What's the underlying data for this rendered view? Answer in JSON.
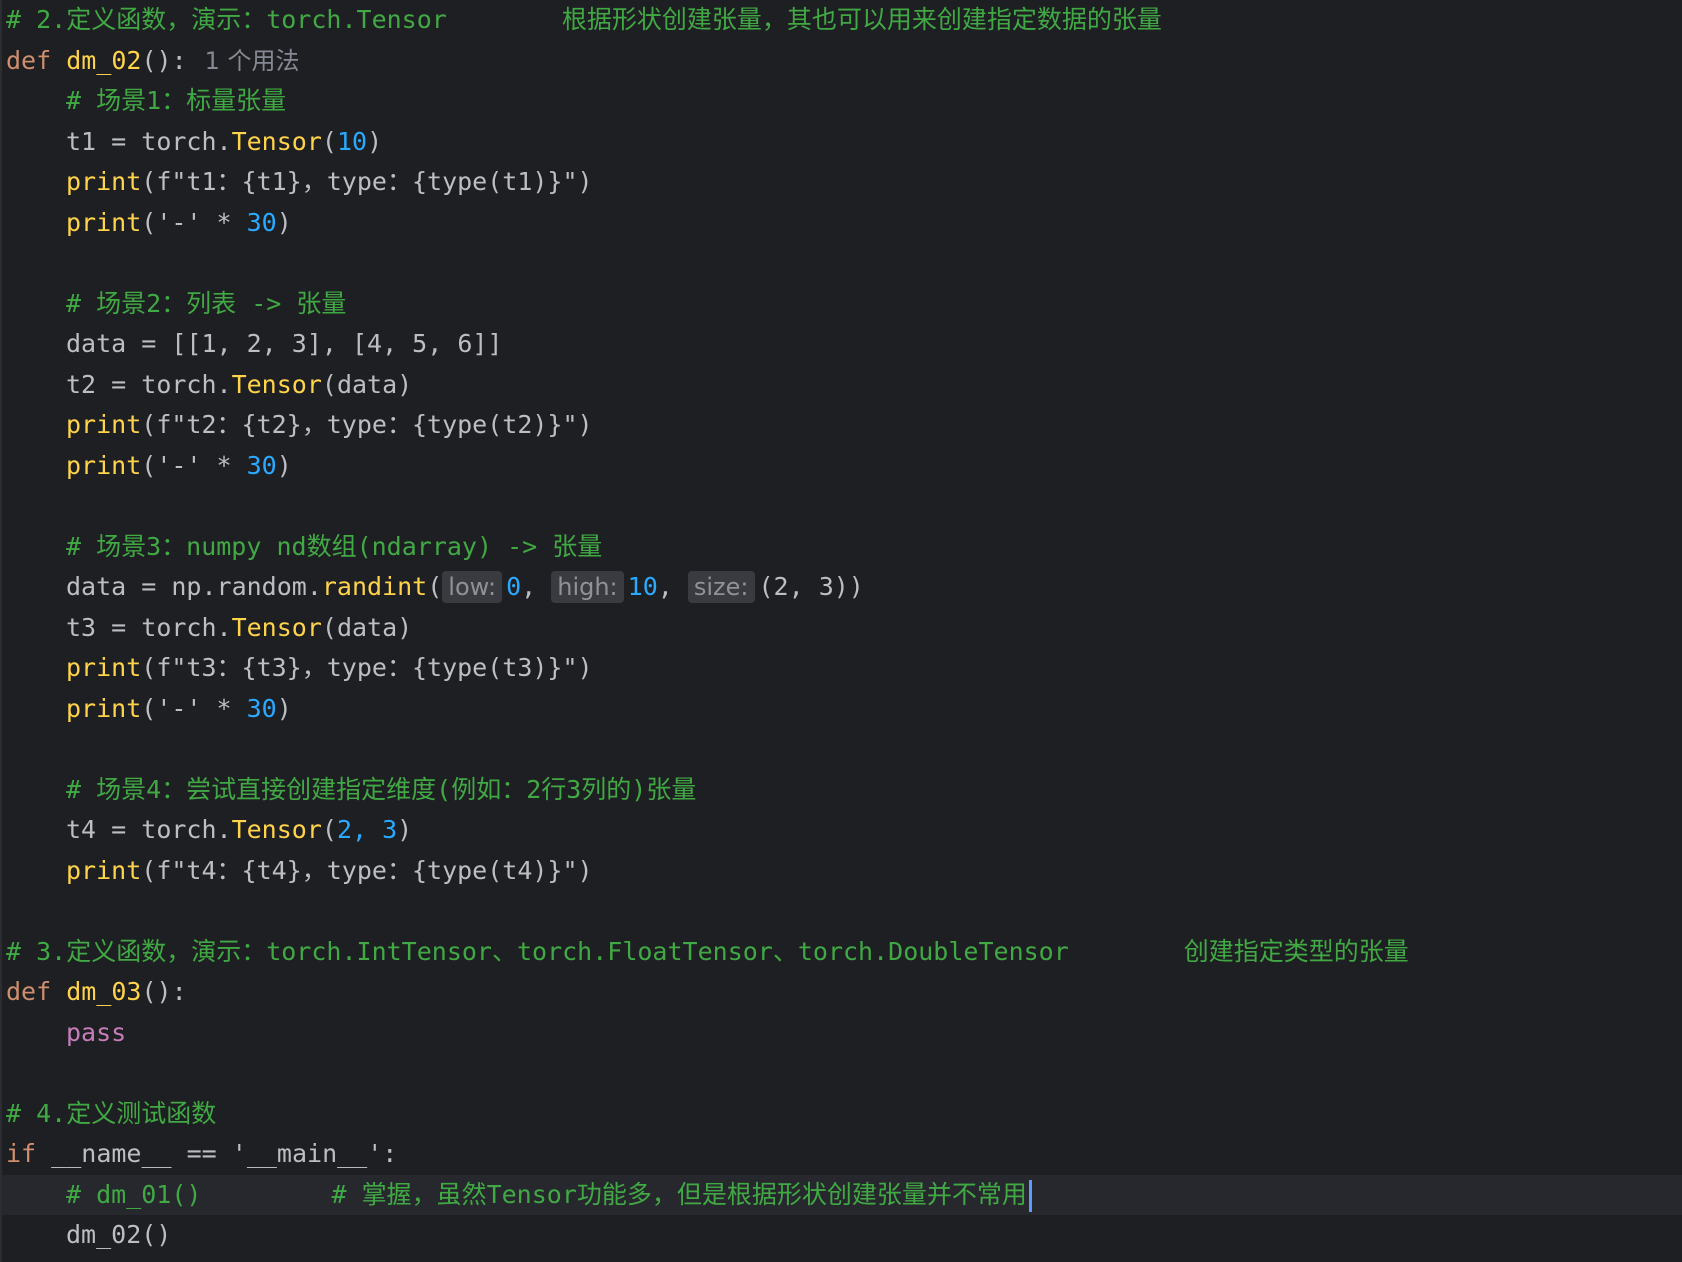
{
  "editor": {
    "lines": [
      {
        "c1": "# 2.定义函数，演示：torch.Tensor",
        "c2": "根据形状创建张量，其也可以用来创建指定数据的张量"
      },
      {
        "kw": "def",
        "name": "dm_02",
        "rest": "():",
        "usages": "1 个用法"
      },
      {
        "comment": "# 场景1：标量张量"
      },
      {
        "var": "t1",
        "eq": " = torch.",
        "meth": "Tensor",
        "open": "(",
        "arg": "10",
        "close": ")"
      },
      {
        "pr": "print",
        "s1": "(f\"t1：",
        "b1": "{t1}",
        "s2": "，type：",
        "b2": "{type(t1)}",
        "s3": "\")"
      },
      {
        "pr": "print",
        "s1": "('-' * ",
        "num": "30",
        "s2": ")"
      },
      {},
      {
        "comment": "# 场景2：列表 -> 张量"
      },
      {
        "text": "data = [[1, 2, 3], [4, 5, 6]]"
      },
      {
        "var": "t2",
        "eq": " = torch.",
        "meth": "Tensor",
        "rest": "(data)"
      },
      {
        "pr": "print",
        "s1": "(f\"t2：",
        "b1": "{t2}",
        "s2": "，type：",
        "b2": "{type(t2)}",
        "s3": "\")"
      },
      {
        "pr": "print",
        "s1": "('-' * ",
        "num": "30",
        "s2": ")"
      },
      {},
      {
        "comment": "# 场景3：numpy nd数组(ndarray) -> 张量"
      },
      {
        "pre": "data = np.random.",
        "meth": "randint",
        "open": "(",
        "h1": "low:",
        "v1": "0",
        "h2": "high:",
        "v2": "10",
        "h3": "size:",
        "tail": "(2, 3))"
      },
      {
        "var": "t3",
        "eq": " = torch.",
        "meth": "Tensor",
        "rest": "(data)"
      },
      {
        "pr": "print",
        "s1": "(f\"t3：",
        "b1": "{t3}",
        "s2": "，type：",
        "b2": "{type(t3)}",
        "s3": "\")"
      },
      {
        "pr": "print",
        "s1": "('-' * ",
        "num": "30",
        "s2": ")"
      },
      {},
      {
        "comment": "# 场景4：尝试直接创建指定维度(例如：2行3列的)张量"
      },
      {
        "var": "t4",
        "eq": " = torch.",
        "meth": "Tensor",
        "open": "(",
        "arg": "2, 3",
        "close": ")"
      },
      {
        "pr": "print",
        "s1": "(f\"t4：",
        "b1": "{t4}",
        "s2": "，type：",
        "b2": "{type(t4)}",
        "s3": "\")"
      },
      {},
      {
        "c1": "# 3.定义函数，演示：torch.IntTensor、torch.FloatTensor、torch.DoubleTensor",
        "c2": "创建指定类型的张量"
      },
      {
        "kw": "def",
        "name": "dm_03",
        "rest": "():"
      },
      {
        "pass": "pass"
      },
      {},
      {
        "comment": "# 4.定义测试函数"
      },
      {
        "kw": "if",
        "rest": " __name__ == '__main__':"
      },
      {
        "c1": "# dm_01()",
        "c2": "# 掌握，虽然Tensor功能多，但是根据形状创建张量并不常用"
      },
      {
        "text": "dm_02()"
      }
    ]
  }
}
